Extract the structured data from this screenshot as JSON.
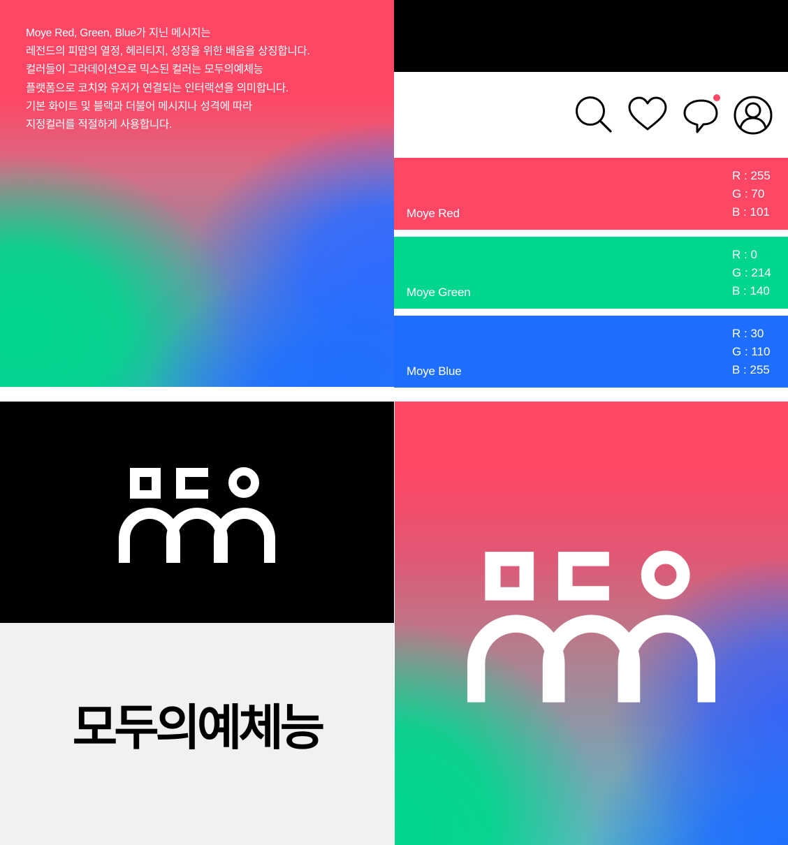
{
  "intro": {
    "lines": [
      "Moye Red, Green, Blue가 지닌 메시지는",
      "레전드의 피땀의 열정, 헤리티지, 성장을 위한 배움을 상징합니다.",
      "컬러들이 그라데이션으로 믹스된 컬러는 모두의예체능",
      "플랫폼으로 코치와 유저가 연결되는 인터랙션을 의미합니다.",
      "기본 화이트 및 블랙과 더불어 메시지나 성격에 따라",
      "지정컬러를 적절하게 사용합니다."
    ]
  },
  "icons": [
    "search-icon",
    "heart-icon",
    "chat-icon",
    "user-icon"
  ],
  "notification_dot_color": "#ff4665",
  "swatches": [
    {
      "name": "Moye Red",
      "hex": "#ff4665",
      "r": "R : 255",
      "g": "G : 70",
      "b": "B : 101"
    },
    {
      "name": "Moye Green",
      "hex": "#00d68c",
      "r": "R : 0",
      "g": "G : 214",
      "b": "B : 140"
    },
    {
      "name": "Moye Blue",
      "hex": "#1e6eff",
      "r": "R : 30",
      "g": "G : 110",
      "b": "B : 255"
    }
  ],
  "logo": {
    "mark": "moye-logo-mark",
    "wordmark": "모두의예체능"
  }
}
